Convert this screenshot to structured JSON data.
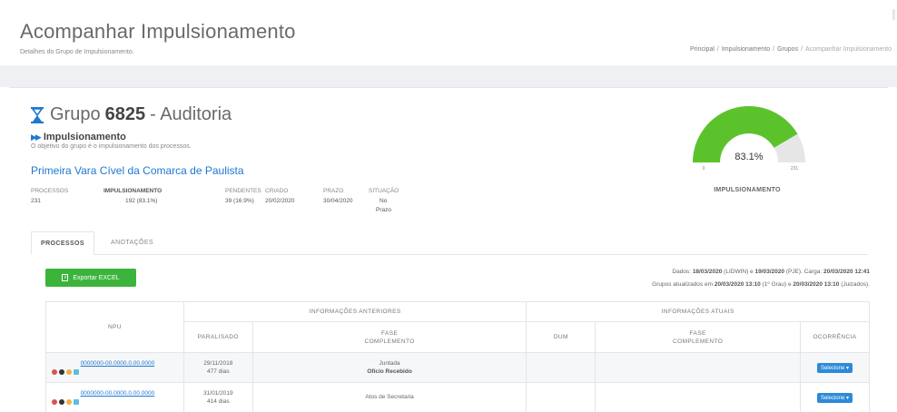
{
  "header": {
    "title": "Acompanhar Impulsionamento",
    "subtitle": "Detalhes do Grupo de Impulsionamento.",
    "breadcrumb": [
      "Principal",
      "Impulsionamento",
      "Grupos",
      "Acompanhar Impulsionamento"
    ]
  },
  "group": {
    "prefix": "Grupo",
    "number": "6825",
    "suffix": "- Auditoria",
    "impuls_label": "Impulsionamento",
    "objective": "O objetivo do grupo é o impulsionamento dos processos.",
    "vara": "Primeira Vara Cível da Comarca de Paulista"
  },
  "stats": {
    "processos": {
      "label": "Processos",
      "value": "231"
    },
    "impulsionamento": {
      "label": "Impulsionamento",
      "value": "192 (83.1%)"
    },
    "pendentes": {
      "label": "Pendentes",
      "value": "39 (16.9%)"
    },
    "criado": {
      "label": "Criado",
      "value": "20/02/2020"
    },
    "prazo": {
      "label": "Prazo",
      "value": "30/04/2020"
    },
    "situacao": {
      "label": "Situação",
      "value1": "No",
      "value2": "Prazo"
    }
  },
  "gauge": {
    "value_text": "83.1%",
    "fraction": 0.831,
    "min": "0",
    "max": "231",
    "label": "IMPULSIONAMENTO",
    "fill_color": "#5cc22b",
    "track_color": "#e6e6e6"
  },
  "tabs": [
    "PROCESSOS",
    "ANOTAÇÕES"
  ],
  "export_label": "Exportar EXCEL",
  "info": {
    "line1_a": "Dados:",
    "line1_b": "18/03/2020",
    "line1_c": "(LIDWIN) e",
    "line1_d": "19/03/2020",
    "line1_e": "(PJE). Carga:",
    "line1_f": "20/03/2020 12:41",
    "line2_a": "Grupos atualizados em",
    "line2_b": "20/03/2020 13:10",
    "line2_c": "(1º Grau) e",
    "line2_d": "20/03/2020 13:10",
    "line2_e": "(Juizados)."
  },
  "table": {
    "group_prev": "Informações Anteriores",
    "group_curr": "Informações Atuais",
    "col_npu": "NPU",
    "col_paralisado": "Paralisado",
    "col_fase_prev_1": "Fase",
    "col_fase_prev_2": "Complemento",
    "col_dum": "DUM",
    "col_fase_curr_1": "Fase",
    "col_fase_curr_2": "Complemento",
    "col_ocorrencia": "Ocorrência",
    "rows": [
      {
        "npu": "0000000-00.0000.0.00.0000",
        "date": "29/11/2018",
        "days": "477 dias",
        "fase": "Juntada",
        "complemento": "Ofício Recebido",
        "dum": "",
        "fase_atual": "",
        "action": "Selecione ▾"
      },
      {
        "npu": "0000000-00.0000.0.00.0000",
        "date": "31/01/2019",
        "days": "414 dias",
        "fase": "Atos de Secretaria",
        "complemento": "",
        "dum": "",
        "fase_atual": "",
        "action": "Selecione ▾"
      }
    ]
  }
}
